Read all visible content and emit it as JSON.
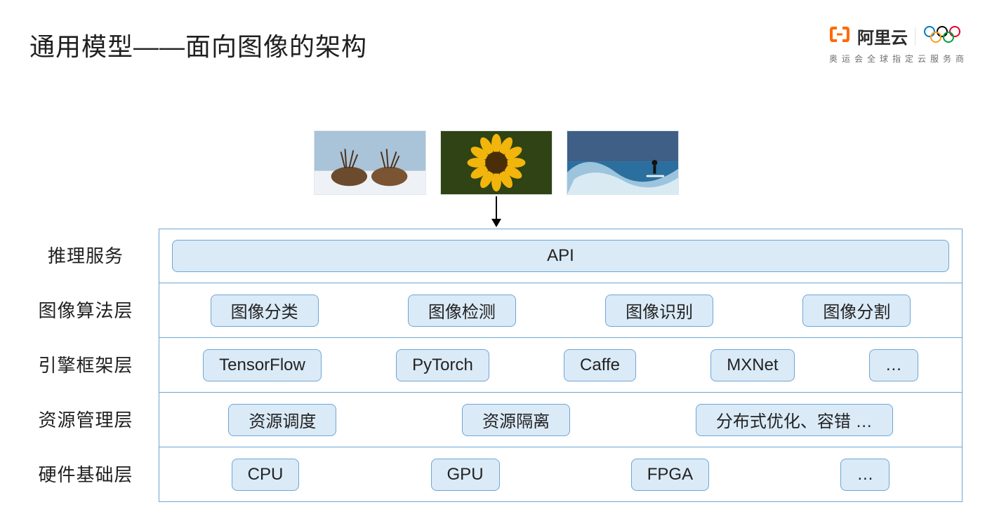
{
  "title": "通用模型——面向图像的架构",
  "brand": {
    "name": "阿里云",
    "subtitle": "奥运会全球指定云服务商"
  },
  "sample_images": [
    {
      "name": "elk-photo"
    },
    {
      "name": "sunflower-photo"
    },
    {
      "name": "surfer-photo"
    }
  ],
  "layers": [
    {
      "label": "推理服务",
      "boxes": [
        "API"
      ],
      "full": true
    },
    {
      "label": "图像算法层",
      "boxes": [
        "图像分类",
        "图像检测",
        "图像识别",
        "图像分割"
      ]
    },
    {
      "label": "引擎框架层",
      "boxes": [
        "TensorFlow",
        "PyTorch",
        "Caffe",
        "MXNet",
        "…"
      ]
    },
    {
      "label": "资源管理层",
      "boxes": [
        "资源调度",
        "资源隔离",
        "分布式优化、容错  …"
      ]
    },
    {
      "label": "硬件基础层",
      "boxes": [
        "CPU",
        "GPU",
        "FPGA",
        "…"
      ]
    }
  ]
}
